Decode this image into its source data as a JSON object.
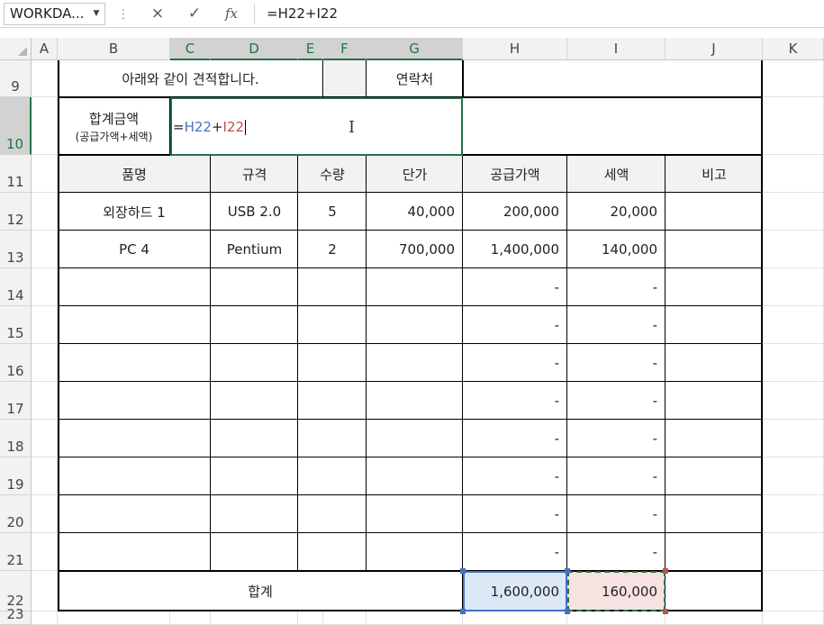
{
  "formula_bar": {
    "name_box": "WORKDA...",
    "cancel_icon": "×",
    "enter_icon": "✓",
    "fx_label": "fx",
    "formula": "=H22+I22"
  },
  "columns": [
    "A",
    "B",
    "C",
    "D",
    "E",
    "F",
    "G",
    "H",
    "I",
    "J",
    "K"
  ],
  "rows": [
    "9",
    "10",
    "11",
    "12",
    "13",
    "14",
    "15",
    "16",
    "17",
    "18",
    "19",
    "20",
    "21",
    "22",
    "23"
  ],
  "sheet": {
    "row9": {
      "intro": "아래와 같이 견적합니다.",
      "contact": "연락처"
    },
    "row10": {
      "total_label": "합계금액",
      "total_sublabel": "(공급가액+세액)",
      "edit_eq": "=",
      "edit_ref1": "H22",
      "edit_plus": "+",
      "edit_ref2": "I22"
    },
    "headers": [
      "품명",
      "규격",
      "수량",
      "단가",
      "공급가액",
      "세액",
      "비고"
    ],
    "items": [
      [
        "외장하드 1",
        "USB 2.0",
        "5",
        "40,000",
        "200,000",
        "20,000",
        ""
      ],
      [
        "PC 4",
        "Pentium",
        "2",
        "700,000",
        "1,400,000",
        "140,000",
        ""
      ],
      [
        "",
        "",
        "",
        "",
        "-",
        "-",
        ""
      ],
      [
        "",
        "",
        "",
        "",
        "-",
        "-",
        ""
      ],
      [
        "",
        "",
        "",
        "",
        "-",
        "-",
        ""
      ],
      [
        "",
        "",
        "",
        "",
        "-",
        "-",
        ""
      ],
      [
        "",
        "",
        "",
        "",
        "-",
        "-",
        ""
      ],
      [
        "",
        "",
        "",
        "",
        "-",
        "-",
        ""
      ],
      [
        "",
        "",
        "",
        "",
        "-",
        "-",
        ""
      ],
      [
        "",
        "",
        "",
        "",
        "-",
        "-",
        ""
      ]
    ],
    "total_row": {
      "label": "합계",
      "supply": "1,600,000",
      "tax": "160,000"
    }
  },
  "colors": {
    "ref1": "#4472c4",
    "ref2": "#c0504d",
    "select": "#217346"
  }
}
